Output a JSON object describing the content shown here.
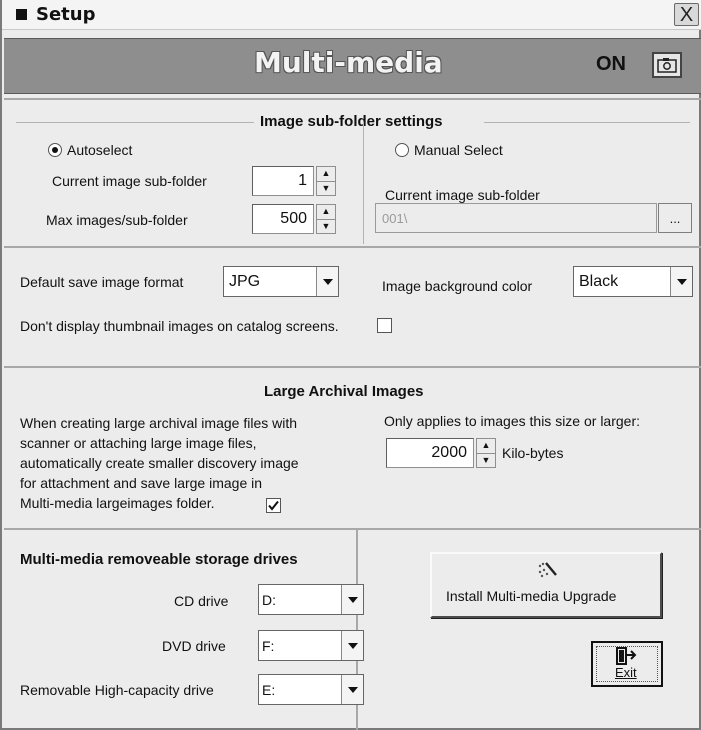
{
  "window": {
    "title": "Setup",
    "close_glyph": "X"
  },
  "header": {
    "title": "Multi-media",
    "status": "ON",
    "status_icon": "camera-icon"
  },
  "subfolder": {
    "group_title": "Image sub-folder settings",
    "autoselect_label": "Autoselect",
    "autoselect_selected": true,
    "current_label": "Current image sub-folder",
    "current_value": "1",
    "max_label": "Max images/sub-folder",
    "max_value": "500",
    "manual_label": "Manual Select",
    "manual_selected": false,
    "manual_current_label": "Current image sub-folder",
    "manual_folder_value": "001\\",
    "browse_label": "..."
  },
  "format": {
    "save_format_label": "Default save image format",
    "save_format_value": "JPG",
    "bg_color_label": "Image background color",
    "bg_color_value": "Black",
    "thumbnail_label": "Don't display thumbnail images on catalog screens.",
    "thumbnail_checked": false
  },
  "archival": {
    "title": "Large Archival Images",
    "description_lines": [
      "When creating large archival image files with",
      "scanner or attaching large image files,",
      "automatically create smaller discovery image",
      "for attachment and save large image in",
      "Multi-media largeimages folder."
    ],
    "save_large_checked": true,
    "threshold_label": "Only applies to images this size or larger:",
    "threshold_value": "2000",
    "threshold_unit": "Kilo-bytes"
  },
  "drives": {
    "title": "Multi-media removeable storage drives",
    "cd_label": "CD drive",
    "cd_value": "D:",
    "dvd_label": "DVD drive",
    "dvd_value": "F:",
    "removable_label": "Removable High-capacity drive",
    "removable_value": "E:"
  },
  "actions": {
    "install_label": "Install Multi-media Upgrade",
    "exit_label": "Exit"
  }
}
